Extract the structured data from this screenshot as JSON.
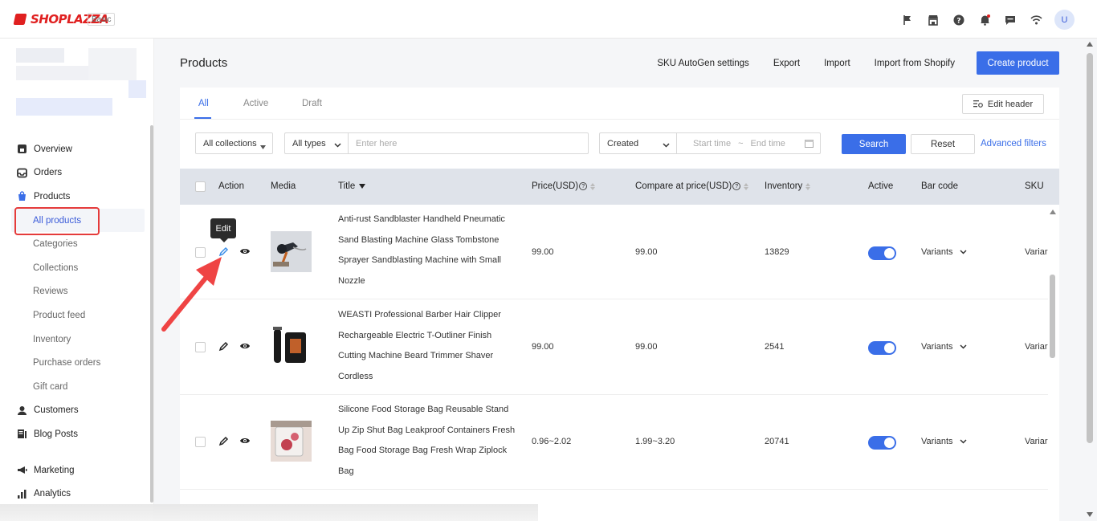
{
  "topbar": {
    "brand": "SHOPLAZZA",
    "plan": "Basic",
    "icons": [
      "flag-icon",
      "store-icon",
      "help-icon",
      "bell-icon",
      "chat-icon",
      "wifi-icon"
    ],
    "avatar_initial": "U"
  },
  "sidebar": {
    "items": [
      {
        "label": "Overview",
        "icon": "home-icon",
        "type": "main"
      },
      {
        "label": "Orders",
        "icon": "inbox-icon",
        "type": "main"
      },
      {
        "label": "Products",
        "icon": "bag-icon",
        "type": "main"
      },
      {
        "label": "All products",
        "type": "sub-active"
      },
      {
        "label": "Categories",
        "type": "sub"
      },
      {
        "label": "Collections",
        "type": "sub"
      },
      {
        "label": "Reviews",
        "type": "sub"
      },
      {
        "label": "Product feed",
        "type": "sub"
      },
      {
        "label": "Inventory",
        "type": "sub"
      },
      {
        "label": "Purchase orders",
        "type": "sub"
      },
      {
        "label": "Gift card",
        "type": "sub"
      },
      {
        "label": "Customers",
        "icon": "person-icon",
        "type": "main"
      },
      {
        "label": "Blog Posts",
        "icon": "blog-icon",
        "type": "main"
      },
      {
        "label": "Marketing",
        "icon": "megaphone-icon",
        "type": "main"
      },
      {
        "label": "Analytics",
        "icon": "bar-chart-icon",
        "type": "main"
      }
    ]
  },
  "header": {
    "title": "Products",
    "actions": [
      "SKU AutoGen settings",
      "Export",
      "Import",
      "Import from Shopify"
    ],
    "primary": "Create product"
  },
  "tabs": [
    "All",
    "Active",
    "Draft"
  ],
  "edit_header_label": "Edit header",
  "filters": {
    "collections": "All collections",
    "types": "All types",
    "search_placeholder": "Enter here",
    "date_field": "Created",
    "start_placeholder": "Start time",
    "range_sep": "~",
    "end_placeholder": "End time",
    "search_label": "Search",
    "reset_label": "Reset",
    "advanced_label": "Advanced filters"
  },
  "columns": {
    "action": "Action",
    "media": "Media",
    "title": "Title",
    "price": "Price(USD)",
    "compare": "Compare at price(USD)",
    "inventory": "Inventory",
    "active": "Active",
    "barcode": "Bar code",
    "sku": "SKU"
  },
  "rows": [
    {
      "title": "Anti-rust Sandblaster Handheld Pneumatic Sand Blasting Machine Glass Tombstone Sprayer Sandblasting Machine with Small Nozzle",
      "price": "99.00",
      "compare": "99.00",
      "inventory": "13829",
      "active": true,
      "barcode": "Variants",
      "sku": "Variar"
    },
    {
      "title": "WEASTI Professional Barber Hair Clipper Rechargeable Electric T-Outliner Finish Cutting Machine Beard Trimmer Shaver Cordless",
      "price": "99.00",
      "compare": "99.00",
      "inventory": "2541",
      "active": true,
      "barcode": "Variants",
      "sku": "Variar"
    },
    {
      "title": "Silicone Food Storage Bag Reusable Stand Up Zip Shut Bag Leakproof Containers Fresh Bag Food Storage Bag Fresh Wrap Ziplock Bag",
      "price": "0.96~2.02",
      "compare": "1.99~3.20",
      "inventory": "20741",
      "active": true,
      "barcode": "Variants",
      "sku": "Variar"
    }
  ],
  "tooltip": "Edit",
  "colors": {
    "accent": "#3a6ee8",
    "brand": "#e02020",
    "highlight": "#e53b3b"
  }
}
